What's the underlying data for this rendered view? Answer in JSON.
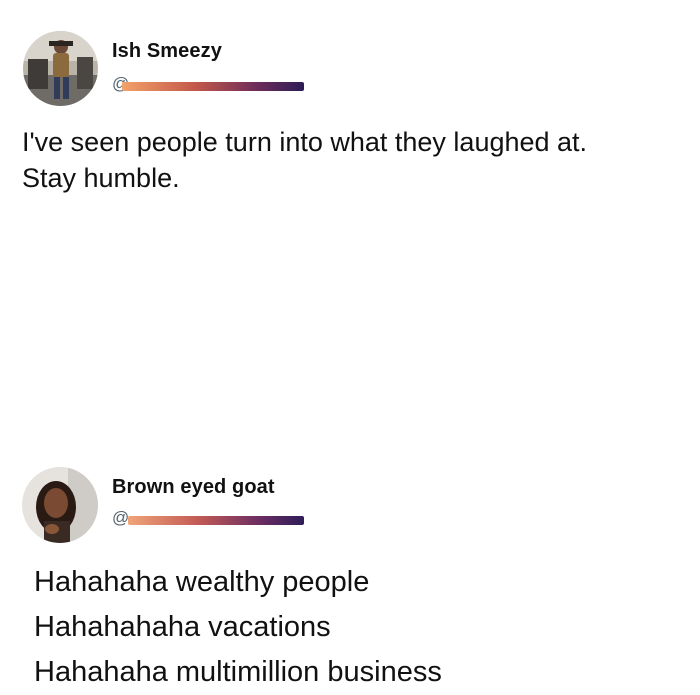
{
  "posts": [
    {
      "author_name": "Ish Smeezy",
      "handle_visible": "@",
      "lines": [
        "I've seen people turn into what they laughed at.",
        "Stay humble."
      ]
    },
    {
      "author_name": "Brown eyed goat",
      "handle_visible": "@",
      "lines": [
        "Hahahaha wealthy people",
        "Hahahahaha vacations",
        "Hahahaha multimillion business"
      ]
    }
  ],
  "colors": {
    "text": "#111111",
    "handle": "#536471",
    "redaction_start": "#f3a36b",
    "redaction_end": "#2d1d55"
  }
}
